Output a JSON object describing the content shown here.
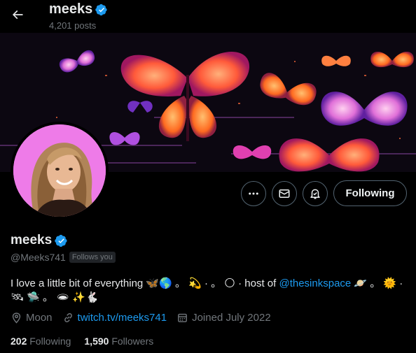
{
  "header": {
    "title": "meeks",
    "post_count": "4,201 posts"
  },
  "profile": {
    "display_name": "meeks",
    "handle": "@Meeks741",
    "follows_badge": "Follows you",
    "bio": {
      "part1": "I love a little bit of everything 🦋🌎 。 💫 · 。 🌕 ·  host of ",
      "mention": "@thesinkspace",
      "part2": " 🪐 。 🌞 · 🛰 🛸 。 🕳 ✨🐇"
    },
    "location": "Moon",
    "website": "twitch.tv/meeks741",
    "joined": "Joined July 2022",
    "following_count": "202",
    "following_label": "Following",
    "followers_count": "1,590",
    "followers_label": "Followers"
  },
  "actions": {
    "follow_label": "Following"
  },
  "colors": {
    "accent": "#1d9bf0",
    "verified": "#1d9bf0",
    "muted": "#71767b"
  },
  "icons": [
    "back-arrow-icon",
    "verified-badge-icon",
    "more-icon",
    "mail-icon",
    "bell-icon",
    "location-icon",
    "link-icon",
    "calendar-icon"
  ]
}
